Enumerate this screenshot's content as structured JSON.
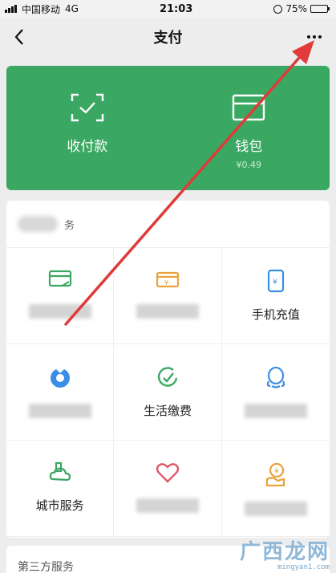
{
  "status_bar": {
    "carrier": "中国移动",
    "network": "4G",
    "time": "21:03",
    "battery": "75%",
    "battery_level": 0.75
  },
  "nav": {
    "title": "支付"
  },
  "wallet_card": {
    "receive_pay_label": "收付款",
    "wallet_label": "钱包",
    "wallet_balance": "¥0.49"
  },
  "services": {
    "header_suffix": "务",
    "items": [
      {
        "label": "",
        "icon": "credit-card-icon",
        "color": "#3aa862"
      },
      {
        "label": "",
        "icon": "wallet-box-icon",
        "color": "#e9a23b"
      },
      {
        "label": "手机充值",
        "icon": "phone-recharge-icon",
        "color": "#3a8ee6"
      },
      {
        "label": "",
        "icon": "drop-circle-icon",
        "color": "#3a8ee6"
      },
      {
        "label": "生活缴费",
        "icon": "check-circle-icon",
        "color": "#3aa862"
      },
      {
        "label": "",
        "icon": "qq-penguin-icon",
        "color": "#3a8ee6"
      },
      {
        "label": "城市服务",
        "icon": "city-cloud-icon",
        "color": "#3aa862"
      },
      {
        "label": "",
        "icon": "heart-icon",
        "color": "#e05a6a"
      },
      {
        "label": "",
        "icon": "coin-hand-icon",
        "color": "#e9a23b"
      }
    ]
  },
  "third_party": {
    "label": "第三方服务"
  },
  "watermark": {
    "brand": "广西龙网",
    "domain": "mingyan1.com"
  },
  "colors": {
    "accent_green": "#3aa862",
    "annotation_red": "#e03a3a"
  }
}
